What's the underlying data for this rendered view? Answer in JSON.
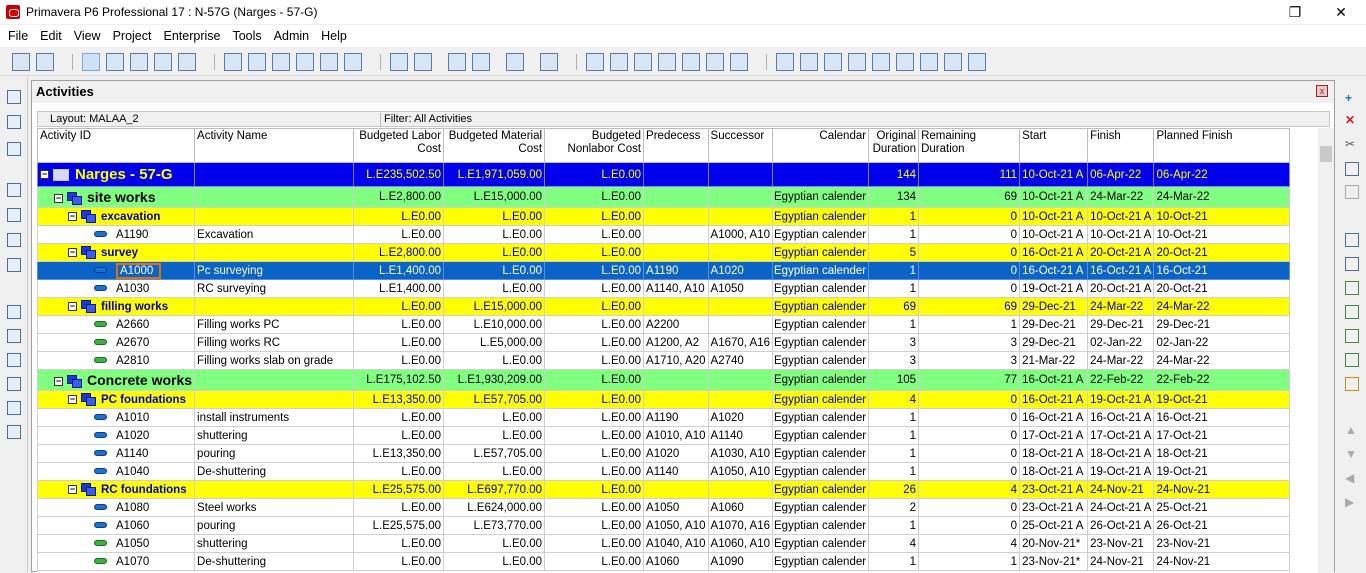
{
  "window": {
    "title": "Primavera P6 Professional 17 : N-57G (Narges - 57-G)",
    "buttons": {
      "restore": "❐",
      "close": "✕"
    }
  },
  "menu": [
    {
      "label": "File"
    },
    {
      "label": "Edit"
    },
    {
      "label": "View"
    },
    {
      "label": "Project"
    },
    {
      "label": "Enterprise"
    },
    {
      "label": "Tools"
    },
    {
      "label": "Admin"
    },
    {
      "label": "Help"
    }
  ],
  "panel": {
    "title": "Activities",
    "close": "x",
    "layout_label": "Layout: MALAA_2",
    "filter_label": "Filter: All Activities"
  },
  "columns": [
    "Activity ID",
    "Activity Name",
    "Budgeted Labor Cost",
    "Budgeted Material Cost",
    "Budgeted Nonlabor Cost",
    "Predecess",
    "Successor",
    "Calendar",
    "Original Duration",
    "Remaining Duration",
    "Start",
    "Finish",
    "Planned Finish"
  ],
  "rows": [
    {
      "type": "proj",
      "id": "Narges - 57-G",
      "name": "",
      "labor": "L.E235,502.50",
      "material": "L.E1,971,059.00",
      "nonlabor": "L.E0.00",
      "pred": "",
      "succ": "",
      "cal": "",
      "od": "144",
      "rd": "111",
      "start": "10-Oct-21 A",
      "finish": "06-Apr-22",
      "pf": "06-Apr-22"
    },
    {
      "type": "wbs1",
      "id": "site works",
      "name": "",
      "labor": "L.E2,800.00",
      "material": "L.E15,000.00",
      "nonlabor": "L.E0.00",
      "pred": "",
      "succ": "",
      "cal": "Egyptian calender",
      "od": "134",
      "rd": "69",
      "start": "10-Oct-21 A",
      "finish": "24-Mar-22",
      "pf": "24-Mar-22"
    },
    {
      "type": "wbs2",
      "id": "excavation",
      "name": "",
      "labor": "L.E0.00",
      "material": "L.E0.00",
      "nonlabor": "L.E0.00",
      "pred": "",
      "succ": "",
      "cal": "Egyptian calender",
      "od": "1",
      "rd": "0",
      "start": "10-Oct-21 A",
      "finish": "10-Oct-21 A",
      "pf": "10-Oct-21"
    },
    {
      "type": "act",
      "bar": "blue",
      "id": "A1190",
      "name": "Excavation",
      "labor": "L.E0.00",
      "material": "L.E0.00",
      "nonlabor": "L.E0.00",
      "pred": "",
      "succ": "A1000, A10",
      "cal": "Egyptian calender",
      "od": "1",
      "rd": "0",
      "start": "10-Oct-21 A",
      "finish": "10-Oct-21 A",
      "pf": "10-Oct-21"
    },
    {
      "type": "wbs2",
      "id": "survey",
      "name": "",
      "labor": "L.E2,800.00",
      "material": "L.E0.00",
      "nonlabor": "L.E0.00",
      "pred": "",
      "succ": "",
      "cal": "Egyptian calender",
      "od": "5",
      "rd": "0",
      "start": "16-Oct-21 A",
      "finish": "20-Oct-21 A",
      "pf": "20-Oct-21"
    },
    {
      "type": "act",
      "bar": "blue",
      "sel": true,
      "id": "A1000",
      "name": "Pc surveying",
      "labor": "L.E1,400.00",
      "material": "L.E0.00",
      "nonlabor": "L.E0.00",
      "pred": "A1190",
      "succ": "A1020",
      "cal": "Egyptian calender",
      "od": "1",
      "rd": "0",
      "start": "16-Oct-21 A",
      "finish": "16-Oct-21 A",
      "pf": "16-Oct-21"
    },
    {
      "type": "act",
      "bar": "blue",
      "id": "A1030",
      "name": "RC surveying",
      "labor": "L.E1,400.00",
      "material": "L.E0.00",
      "nonlabor": "L.E0.00",
      "pred": "A1140, A10",
      "succ": "A1050",
      "cal": "Egyptian calender",
      "od": "1",
      "rd": "0",
      "start": "19-Oct-21 A",
      "finish": "20-Oct-21 A",
      "pf": "20-Oct-21"
    },
    {
      "type": "wbs2",
      "id": "filling works",
      "name": "",
      "labor": "L.E0.00",
      "material": "L.E15,000.00",
      "nonlabor": "L.E0.00",
      "pred": "",
      "succ": "",
      "cal": "Egyptian calender",
      "od": "69",
      "rd": "69",
      "start": "29-Dec-21",
      "finish": "24-Mar-22",
      "pf": "24-Mar-22"
    },
    {
      "type": "act",
      "bar": "green",
      "id": "A2660",
      "name": "Filling works PC",
      "labor": "L.E0.00",
      "material": "L.E10,000.00",
      "nonlabor": "L.E0.00",
      "pred": "A2200",
      "succ": "",
      "cal": "Egyptian calender",
      "od": "1",
      "rd": "1",
      "start": "29-Dec-21",
      "finish": "29-Dec-21",
      "pf": "29-Dec-21"
    },
    {
      "type": "act",
      "bar": "green",
      "id": "A2670",
      "name": "Filling works RC",
      "labor": "L.E0.00",
      "material": "L.E5,000.00",
      "nonlabor": "L.E0.00",
      "pred": "A1200, A2",
      "succ": "A1670, A16",
      "cal": "Egyptian calender",
      "od": "3",
      "rd": "3",
      "start": "29-Dec-21",
      "finish": "02-Jan-22",
      "pf": "02-Jan-22"
    },
    {
      "type": "act",
      "bar": "green",
      "id": "A2810",
      "name": "Filling works slab on grade",
      "labor": "L.E0.00",
      "material": "L.E0.00",
      "nonlabor": "L.E0.00",
      "pred": "A1710, A20",
      "succ": "A2740",
      "cal": "Egyptian calender",
      "od": "3",
      "rd": "3",
      "start": "21-Mar-22",
      "finish": "24-Mar-22",
      "pf": "24-Mar-22"
    },
    {
      "type": "wbs1",
      "id": "Concrete works",
      "name": "",
      "labor": "L.E175,102.50",
      "material": "L.E1,930,209.00",
      "nonlabor": "L.E0.00",
      "pred": "",
      "succ": "",
      "cal": "Egyptian calender",
      "od": "105",
      "rd": "77",
      "start": "16-Oct-21 A",
      "finish": "22-Feb-22",
      "pf": "22-Feb-22"
    },
    {
      "type": "wbs2",
      "id": "PC foundations",
      "name": "",
      "labor": "L.E13,350.00",
      "material": "L.E57,705.00",
      "nonlabor": "L.E0.00",
      "pred": "",
      "succ": "",
      "cal": "Egyptian calender",
      "od": "4",
      "rd": "0",
      "start": "16-Oct-21 A",
      "finish": "19-Oct-21 A",
      "pf": "19-Oct-21"
    },
    {
      "type": "act",
      "bar": "blue",
      "id": "A1010",
      "name": "install instruments",
      "labor": "L.E0.00",
      "material": "L.E0.00",
      "nonlabor": "L.E0.00",
      "pred": "A1190",
      "succ": "A1020",
      "cal": "Egyptian calender",
      "od": "1",
      "rd": "0",
      "start": "16-Oct-21 A",
      "finish": "16-Oct-21 A",
      "pf": "16-Oct-21"
    },
    {
      "type": "act",
      "bar": "blue",
      "id": "A1020",
      "name": "shuttering",
      "labor": "L.E0.00",
      "material": "L.E0.00",
      "nonlabor": "L.E0.00",
      "pred": "A1010, A10",
      "succ": "A1140",
      "cal": "Egyptian calender",
      "od": "1",
      "rd": "0",
      "start": "17-Oct-21 A",
      "finish": "17-Oct-21 A",
      "pf": "17-Oct-21"
    },
    {
      "type": "act",
      "bar": "blue",
      "id": "A1140",
      "name": "pouring",
      "labor": "L.E13,350.00",
      "material": "L.E57,705.00",
      "nonlabor": "L.E0.00",
      "pred": "A1020",
      "succ": "A1030, A10",
      "cal": "Egyptian calender",
      "od": "1",
      "rd": "0",
      "start": "18-Oct-21 A",
      "finish": "18-Oct-21 A",
      "pf": "18-Oct-21"
    },
    {
      "type": "act",
      "bar": "blue",
      "id": "A1040",
      "name": "De-shuttering",
      "labor": "L.E0.00",
      "material": "L.E0.00",
      "nonlabor": "L.E0.00",
      "pred": "A1140",
      "succ": "A1050, A10",
      "cal": "Egyptian calender",
      "od": "1",
      "rd": "0",
      "start": "18-Oct-21 A",
      "finish": "19-Oct-21 A",
      "pf": "19-Oct-21"
    },
    {
      "type": "wbs2",
      "id": "RC foundations",
      "name": "",
      "labor": "L.E25,575.00",
      "material": "L.E697,770.00",
      "nonlabor": "L.E0.00",
      "pred": "",
      "succ": "",
      "cal": "Egyptian calender",
      "od": "26",
      "rd": "4",
      "start": "23-Oct-21 A",
      "finish": "24-Nov-21",
      "pf": "24-Nov-21"
    },
    {
      "type": "act",
      "bar": "blue",
      "id": "A1080",
      "name": "Steel works",
      "labor": "L.E0.00",
      "material": "L.E624,000.00",
      "nonlabor": "L.E0.00",
      "pred": "A1050",
      "succ": "A1060",
      "cal": "Egyptian calender",
      "od": "2",
      "rd": "0",
      "start": "23-Oct-21 A",
      "finish": "24-Oct-21 A",
      "pf": "25-Oct-21"
    },
    {
      "type": "act",
      "bar": "blue",
      "id": "A1060",
      "name": "pouring",
      "labor": "L.E25,575.00",
      "material": "L.E73,770.00",
      "nonlabor": "L.E0.00",
      "pred": "A1050, A10",
      "succ": "A1070, A16",
      "cal": "Egyptian calender",
      "od": "1",
      "rd": "0",
      "start": "25-Oct-21 A",
      "finish": "26-Oct-21 A",
      "pf": "26-Oct-21"
    },
    {
      "type": "act",
      "bar": "green",
      "id": "A1050",
      "name": "shuttering",
      "labor": "L.E0.00",
      "material": "L.E0.00",
      "nonlabor": "L.E0.00",
      "pred": "A1040, A10",
      "succ": "A1060, A10",
      "cal": "Egyptian calender",
      "od": "4",
      "rd": "4",
      "start": "20-Nov-21*",
      "finish": "23-Nov-21",
      "pf": "23-Nov-21"
    },
    {
      "type": "act",
      "bar": "green",
      "id": "A1070",
      "name": "De-shuttering",
      "labor": "L.E0.00",
      "material": "L.E0.00",
      "nonlabor": "L.E0.00",
      "pred": "A1060",
      "succ": "A1090",
      "cal": "Egyptian calender",
      "od": "1",
      "rd": "1",
      "start": "23-Nov-21*",
      "finish": "24-Nov-21",
      "pf": "24-Nov-21"
    }
  ]
}
